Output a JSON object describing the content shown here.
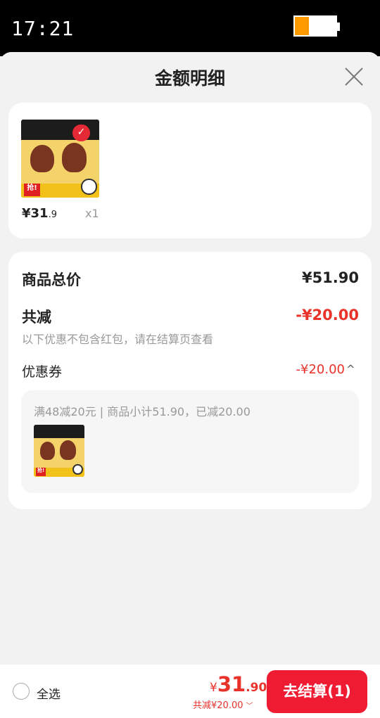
{
  "status_bar": {
    "time": "17:21",
    "battery_level": 0.35
  },
  "sheet": {
    "title": "金额明细"
  },
  "product": {
    "image_badge": "抢!",
    "price_currency": "¥",
    "price_int": "31",
    "price_dec": ".9",
    "quantity": "x1"
  },
  "summary": {
    "total_label": "商品总价",
    "total_value": "¥51.90",
    "reduce_label": "共减",
    "reduce_value": "-¥20.00",
    "reduce_note": "以下优惠不包含红包，请在结算页查看",
    "coupon_label": "优惠券",
    "coupon_value": "-¥20.00",
    "coupon_toggle": "^",
    "coupon_desc": "满48减20元 | 商品小计51.90，已减20.00"
  },
  "bottom_bar": {
    "select_all": "全选",
    "price_currency": "¥",
    "price_int": "31",
    "price_dec": ".90",
    "reduce_text": "共减¥20.00",
    "reduce_arrow": "﹀",
    "checkout_label": "去结算(1)"
  },
  "colors": {
    "accent": "#e8322a",
    "checkout": "#ef1b32",
    "battery": "#ff9900"
  }
}
